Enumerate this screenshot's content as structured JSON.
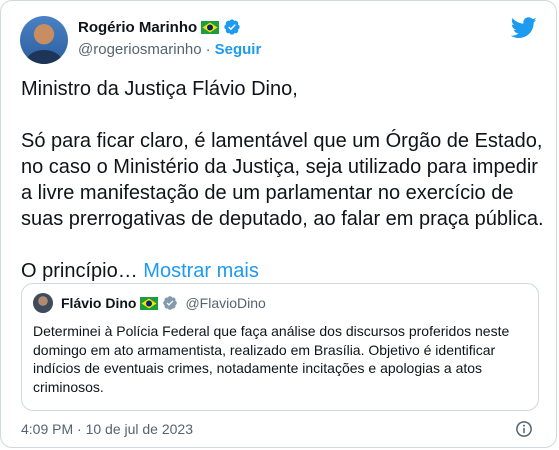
{
  "tweet": {
    "author": {
      "name": "Rogério Marinho",
      "handle": "@rogeriosmarinho",
      "separator": "·",
      "follow_label": "Seguir"
    },
    "paragraphs": [
      "Ministro da Justiça Flávio Dino,",
      "Só para ficar claro, é lamentável que um Órgão de Estado, no caso o Ministério da Justiça, seja utilizado para impedir a livre manifestação de um parlamentar no exercício de suas prerrogativas de deputado, ao falar em praça pública."
    ],
    "truncated_text": "O princípio…",
    "show_more_label": "Mostrar mais",
    "timestamp": "4:09 PM · 10 de jul de 2023"
  },
  "quote": {
    "name": "Flávio Dino",
    "handle": "@FlavioDino",
    "text": "Determinei à Polícia Federal que faça análise dos discursos proferidos neste domingo em ato armamentista, realizado em Brasília. Objetivo é identificar indícios de eventuais crimes, notadamente incitações e apologias a atos criminosos."
  },
  "icons": {
    "brand": "twitter-bird-icon",
    "verified": "verified-badge-icon",
    "flag": "brazil-flag-icon",
    "info": "info-icon"
  },
  "colors": {
    "accent": "#1d9bf0",
    "text": "#0f1419",
    "secondary": "#536471",
    "border": "#cfd9de"
  }
}
